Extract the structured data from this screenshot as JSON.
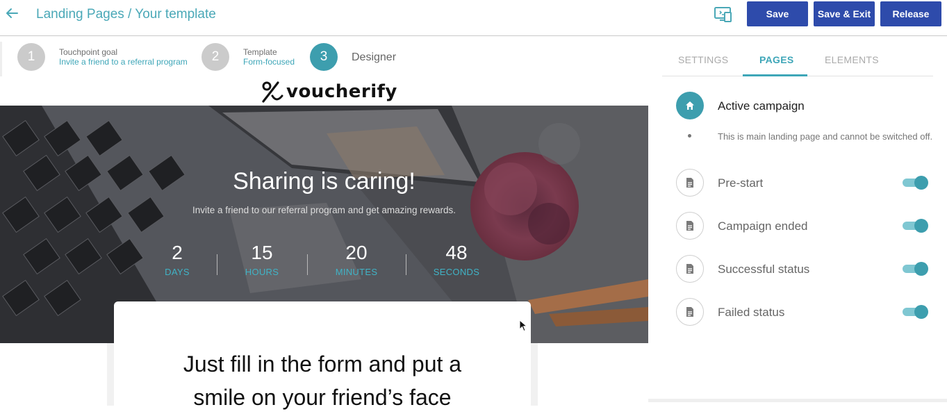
{
  "header": {
    "title": "Landing Pages / Your template",
    "buttons": {
      "save": "Save",
      "save_exit": "Save & Exit",
      "release": "Release"
    },
    "icons": {
      "back": "arrow-left-icon",
      "preview": "device-preview-icon"
    },
    "accent": "#4aa8b7",
    "button_color": "#2e4bab"
  },
  "stepper": {
    "steps": [
      {
        "number": "1",
        "label": "Touchpoint goal",
        "value": "Invite a friend to a referral program"
      },
      {
        "number": "2",
        "label": "Template",
        "value": "Form-focused"
      },
      {
        "number": "3",
        "label": "Designer"
      }
    ]
  },
  "preview": {
    "logo_text": "voucherify",
    "hero_title": "Sharing is caring!",
    "hero_subtitle": "Invite a friend to our referral program and get amazing rewards.",
    "countdown": [
      {
        "value": "2",
        "unit": "DAYS"
      },
      {
        "value": "15",
        "unit": "HOURS"
      },
      {
        "value": "20",
        "unit": "MINUTES"
      },
      {
        "value": "48",
        "unit": "SECONDS"
      }
    ],
    "form_title_line1": "Just fill in the form and put a",
    "form_title_line2": "smile on your friend’s face"
  },
  "panel": {
    "tabs": [
      "SETTINGS",
      "PAGES",
      "ELEMENTS"
    ],
    "active_tab": "PAGES",
    "active_page": {
      "name": "Active campaign",
      "note": "This is main landing page and cannot be switched off.",
      "icon": "home-icon"
    },
    "pages": [
      {
        "name": "Pre-start",
        "enabled": true,
        "icon": "document-icon"
      },
      {
        "name": "Campaign ended",
        "enabled": true,
        "icon": "document-icon"
      },
      {
        "name": "Successful status",
        "enabled": true,
        "icon": "document-icon"
      },
      {
        "name": "Failed status",
        "enabled": true,
        "icon": "document-icon"
      }
    ]
  }
}
